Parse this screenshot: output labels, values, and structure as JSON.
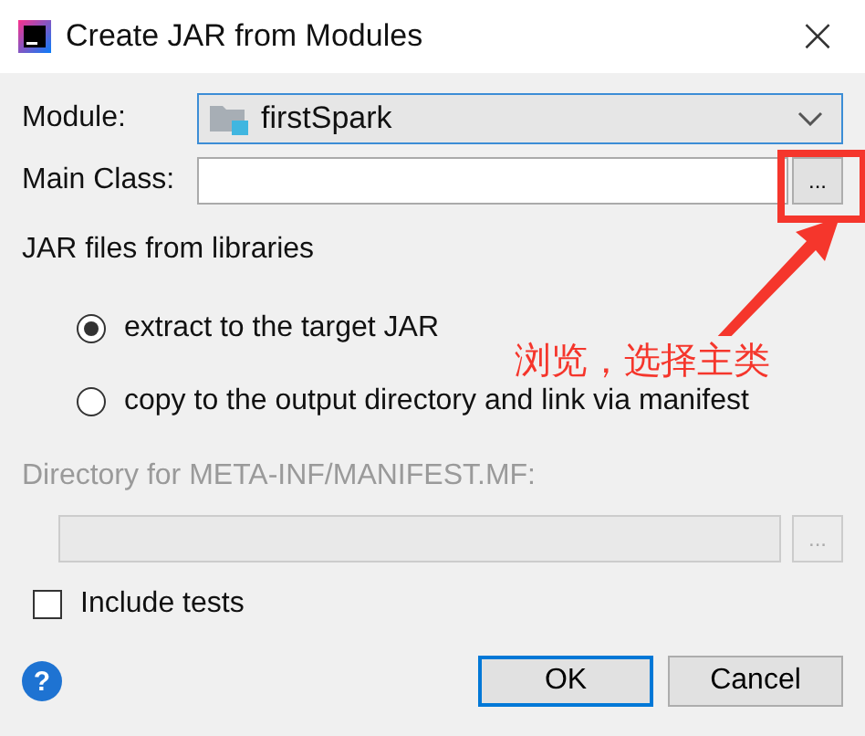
{
  "window": {
    "title": "Create JAR from Modules",
    "close": "×"
  },
  "module": {
    "label": "Module:",
    "value": "firstSpark"
  },
  "main_class": {
    "label": "Main Class:",
    "browse": "..."
  },
  "libraries": {
    "title": "JAR files from libraries",
    "options": [
      {
        "label": "extract to the target JAR",
        "selected": true
      },
      {
        "label": "copy to the output directory and link via manifest",
        "selected": false
      }
    ]
  },
  "annotation": {
    "text": "浏览，选择主类"
  },
  "manifest": {
    "label": "Directory for META-INF/MANIFEST.MF:",
    "browse": "...",
    "disabled": true
  },
  "include_tests": {
    "label": "Include tests",
    "checked": false
  },
  "help": "?",
  "buttons": [
    {
      "label": "OK",
      "default": true
    },
    {
      "label": "Cancel",
      "default": false
    }
  ]
}
